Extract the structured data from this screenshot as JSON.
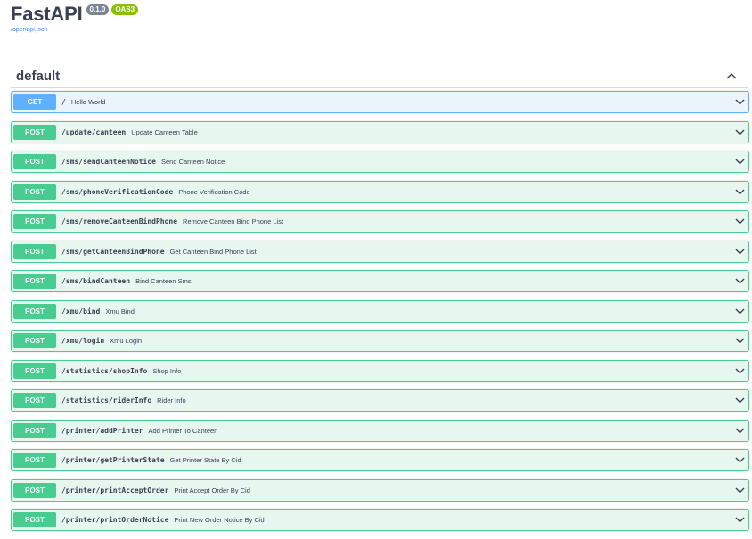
{
  "app": {
    "title": "FastAPI",
    "version_badge": "0.1.0",
    "oas_badge": "OAS3",
    "spec_link": "/openapi.json"
  },
  "section": {
    "title": "default",
    "collapse_icon": "chevron-up-icon"
  },
  "colors": {
    "get": "#61affe",
    "post": "#49cc90",
    "text": "#3b4151",
    "oas_badge": "#89bf04",
    "version_badge": "#7d8492"
  },
  "operations": [
    {
      "method": "GET",
      "path": "/",
      "summary": "Hello World"
    },
    {
      "method": "POST",
      "path": "/update/canteen",
      "summary": "Update Canteen Table"
    },
    {
      "method": "POST",
      "path": "/sms/sendCanteenNotice",
      "summary": "Send Canteen Notice"
    },
    {
      "method": "POST",
      "path": "/sms/phoneVerificationCode",
      "summary": "Phone Verification Code"
    },
    {
      "method": "POST",
      "path": "/sms/removeCanteenBindPhone",
      "summary": "Remove Canteen Bind Phone List"
    },
    {
      "method": "POST",
      "path": "/sms/getCanteenBindPhone",
      "summary": "Get Canteen Bind Phone List"
    },
    {
      "method": "POST",
      "path": "/sms/bindCanteen",
      "summary": "Bind Canteen Sms"
    },
    {
      "method": "POST",
      "path": "/xmu/bind",
      "summary": "Xmu Bind"
    },
    {
      "method": "POST",
      "path": "/xmu/login",
      "summary": "Xmu Login"
    },
    {
      "method": "POST",
      "path": "/statistics/shopInfo",
      "summary": "Shop Info"
    },
    {
      "method": "POST",
      "path": "/statistics/riderInfo",
      "summary": "Rider Info"
    },
    {
      "method": "POST",
      "path": "/printer/addPrinter",
      "summary": "Add Printer To Canteen"
    },
    {
      "method": "POST",
      "path": "/printer/getPrinterState",
      "summary": "Get Printer State By Cid"
    },
    {
      "method": "POST",
      "path": "/printer/printAcceptOrder",
      "summary": "Print Accept Order By Cid"
    },
    {
      "method": "POST",
      "path": "/printer/printOrderNotice",
      "summary": "Print New Order Notice By Cid"
    }
  ]
}
